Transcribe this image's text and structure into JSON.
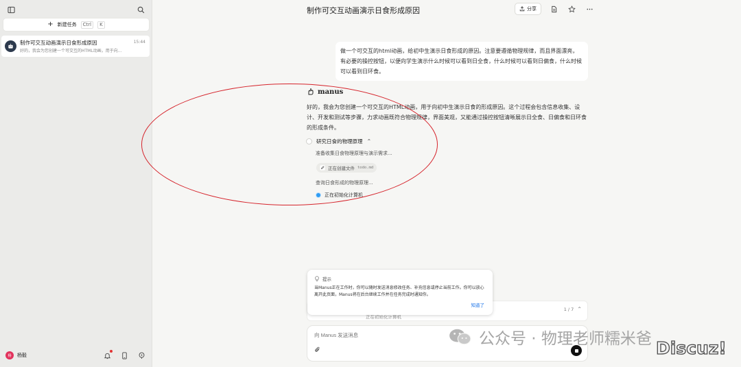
{
  "sidebar": {
    "new_task_label": "新建任务",
    "shortcut_ctrl": "Ctrl",
    "shortcut_key": "K",
    "task": {
      "title": "制作可交互动画演示日食形成原因",
      "time": "15:44",
      "preview": "好的，我会为您创建一个可交互的HTML动画，用于向..."
    },
    "user": {
      "initial": "杨",
      "name": "杨毅"
    }
  },
  "header": {
    "title": "制作可交互动画演示日食形成原因",
    "share_label": "分享"
  },
  "conversation": {
    "user_message": "做一个可交互的html动画，给初中生演示日食形成的原因。注意要遵循物理规律，而且界面漂亮，有必要的操控按钮，以便向学生演示什么时候可以看到日全食，什么时候可以看到日偏食，什么时候可以看到日环食。",
    "assistant_name": "manus",
    "assistant_reply": "好的，我会为您创建一个可交互的HTML动画，用于向初中生演示日食的形成原因。这个过程会包含信息收集、设计、开发和测试等步骤，力求动画既符合物理规律，界面美观，又能通过操控按钮清晰展示日全食、日偏食和日环食的形成条件。",
    "step_title": "研究日食的物理原理",
    "substep_1": "准备收集日食物理原理与演示需求...",
    "file_chip_label": "正在创建文件",
    "file_chip_name": "todo.md",
    "substep_2": "查询日食形成的物理原理...",
    "working_status": "正在初始化计算机"
  },
  "tip": {
    "title": "提示",
    "body": "当Manus正在工作时，你可以随时发送消息修改任务、补充信息或停止当前工作。你可以放心离开此页面，Manus将在后台继续工作并在任务完成时通知你。",
    "ok_label": "知道了"
  },
  "progress": {
    "count": "1 / 7",
    "status": "正在初始化计算机"
  },
  "input": {
    "placeholder": "向 Manus 发送消息"
  },
  "watermarks": {
    "wechat": "公众号 · 物理老师糯米爸",
    "discuz": "Discuz!"
  },
  "colors": {
    "annotation_red": "#d52129",
    "status_blue": "#2f9cf3",
    "link_blue": "#1a73e8"
  }
}
